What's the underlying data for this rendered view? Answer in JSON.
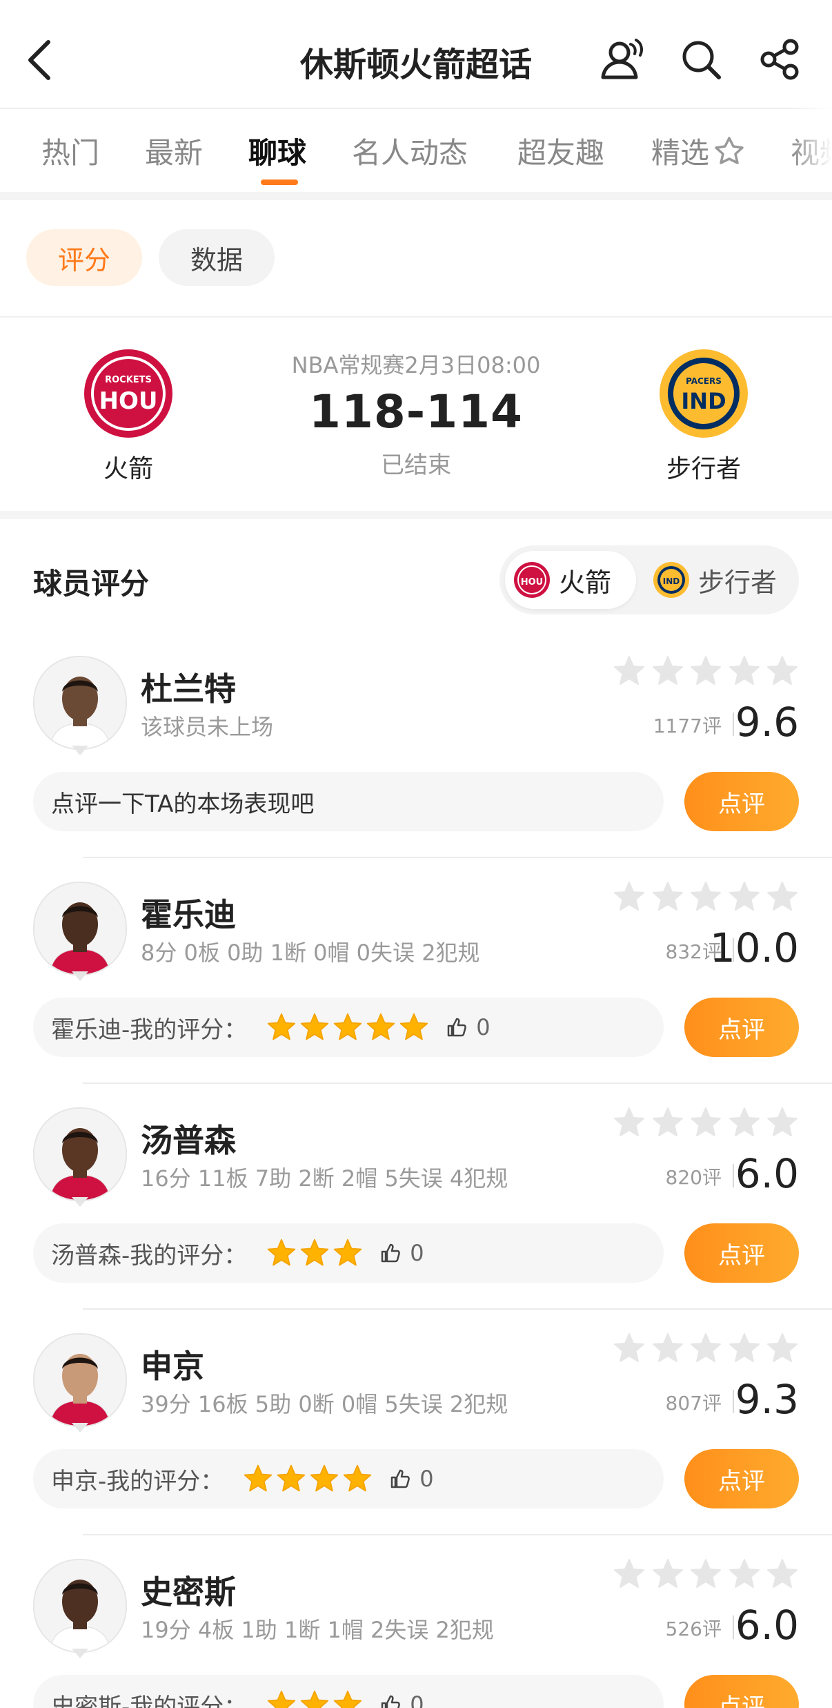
{
  "header": {
    "title": "休斯顿火箭超话"
  },
  "tabs": [
    {
      "label": "热门",
      "active": false
    },
    {
      "label": "最新",
      "active": false
    },
    {
      "label": "聊球",
      "active": true
    },
    {
      "label": "名人动态",
      "active": false
    },
    {
      "label": "超友趣",
      "active": false
    },
    {
      "label": "精选",
      "active": false
    },
    {
      "label": "视频",
      "active": false
    }
  ],
  "filters": [
    {
      "label": "评分",
      "active": true
    },
    {
      "label": "数据",
      "active": false
    }
  ],
  "match": {
    "home_team": "火箭",
    "home_logo_text_top": "ROCKETS",
    "home_logo_text": "HOU",
    "away_team": "步行者",
    "away_logo_text_top": "PACERS",
    "away_logo_text": "IND",
    "info": "NBA常规赛2月3日08:00",
    "score": "118-114",
    "status": "已结束"
  },
  "ratings_section": {
    "title": "球员评分",
    "team_toggle": [
      {
        "label": "火箭",
        "logo_text": "HOU",
        "active": true
      },
      {
        "label": "步行者",
        "logo_text": "IND",
        "active": false
      }
    ],
    "rate_button_label": "点评"
  },
  "players": [
    {
      "name": "杜兰特",
      "stats": "该球员未上场",
      "votes": "1177评",
      "score": "9.6",
      "my_rating_label": "点评一下TA的本场表现吧",
      "my_stars": 0,
      "likes": ""
    },
    {
      "name": "霍乐迪",
      "stats": "8分 0板 0助 1断 0帽 0失误 2犯规",
      "votes": "832评",
      "score": "10.0",
      "my_rating_label": "霍乐迪-我的评分：",
      "my_stars": 5,
      "likes": "0"
    },
    {
      "name": "汤普森",
      "stats": "16分 11板 7助 2断 2帽 5失误 4犯规",
      "votes": "820评",
      "score": "6.0",
      "my_rating_label": "汤普森-我的评分：",
      "my_stars": 3,
      "likes": "0"
    },
    {
      "name": "申京",
      "stats": "39分 16板 5助 0断 0帽 5失误 2犯规",
      "votes": "807评",
      "score": "9.3",
      "my_rating_label": "申京-我的评分：",
      "my_stars": 4,
      "likes": "0"
    },
    {
      "name": "史密斯",
      "stats": "19分 4板 1助 1断 1帽 2失误 2犯规",
      "votes": "526评",
      "score": "6.0",
      "my_rating_label": "史密斯-我的评分：",
      "my_stars": 3,
      "likes": "0"
    }
  ],
  "colors": {
    "accent": "#ff7a1a",
    "star_gold": "#ffb300",
    "rockets_red": "#ce1141",
    "pacers_navy": "#002d62",
    "pacers_gold": "#fdbb30"
  },
  "icons": {
    "back": "back-arrow-icon",
    "users": "users-icon",
    "search": "search-icon",
    "share": "share-icon",
    "like": "thumbs-up-icon"
  }
}
